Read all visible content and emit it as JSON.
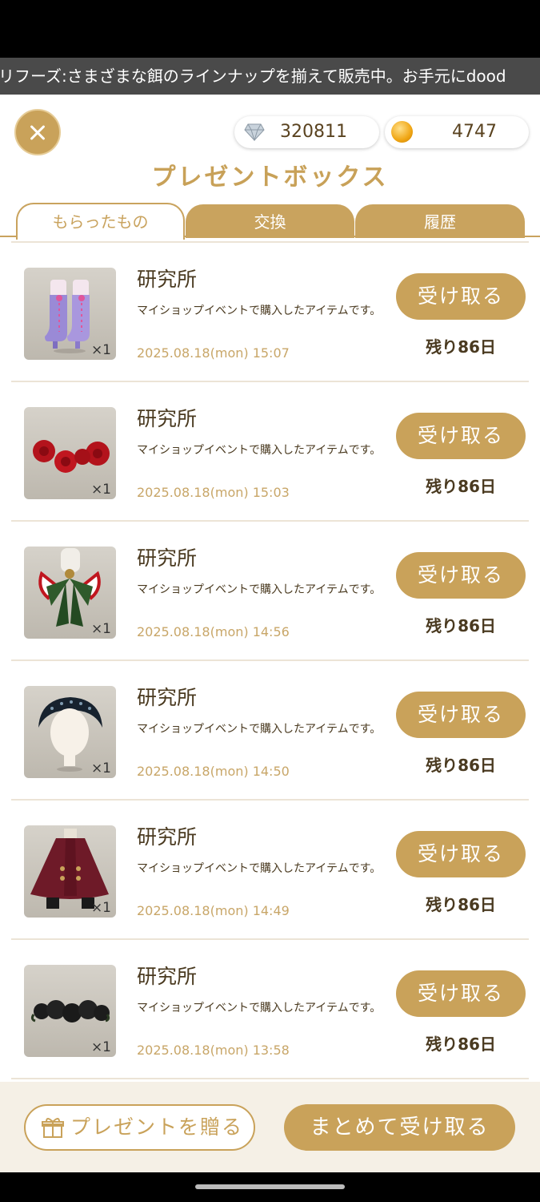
{
  "ticker": {
    "text": "リフーズ:さまざまな餌のラインナップを揃えて販売中。お手元にdood"
  },
  "currency": {
    "gems": "320811",
    "coins": "4747"
  },
  "title": "プレゼントボックス",
  "tabs": [
    {
      "label": "もらったもの",
      "active": true
    },
    {
      "label": "交換",
      "active": false
    },
    {
      "label": "履歴",
      "active": false
    }
  ],
  "items": [
    {
      "name": "研究所",
      "desc": "マイショップイベントで購入したアイテムです。",
      "date": "2025.08.18(mon) 15:07",
      "qty": "×1",
      "button": "受け取る",
      "remaining": "残り86日",
      "icon": "boots-icon"
    },
    {
      "name": "研究所",
      "desc": "マイショップイベントで購入したアイテムです。",
      "date": "2025.08.18(mon) 15:03",
      "qty": "×1",
      "button": "受け取る",
      "remaining": "残り86日",
      "icon": "red-roses-icon"
    },
    {
      "name": "研究所",
      "desc": "マイショップイベントで購入したアイテムです。",
      "date": "2025.08.18(mon) 14:56",
      "qty": "×1",
      "button": "受け取る",
      "remaining": "残り86日",
      "icon": "green-bow-icon"
    },
    {
      "name": "研究所",
      "desc": "マイショップイベントで購入したアイテムです。",
      "date": "2025.08.18(mon) 14:50",
      "qty": "×1",
      "button": "受け取る",
      "remaining": "残り86日",
      "icon": "headdress-icon"
    },
    {
      "name": "研究所",
      "desc": "マイショップイベントで購入したアイテムです。",
      "date": "2025.08.18(mon) 14:49",
      "qty": "×1",
      "button": "受け取る",
      "remaining": "残り86日",
      "icon": "cape-icon"
    },
    {
      "name": "研究所",
      "desc": "マイショップイベントで購入したアイテムです。",
      "date": "2025.08.18(mon) 13:58",
      "qty": "×1",
      "button": "受け取る",
      "remaining": "残り86日",
      "icon": "black-roses-icon"
    }
  ],
  "footer": {
    "gift_label": "プレゼントを贈る",
    "receive_all_label": "まとめて受け取る"
  },
  "colors": {
    "accent": "#c9a25a",
    "text": "#4a3a20",
    "date": "#c8a668"
  }
}
